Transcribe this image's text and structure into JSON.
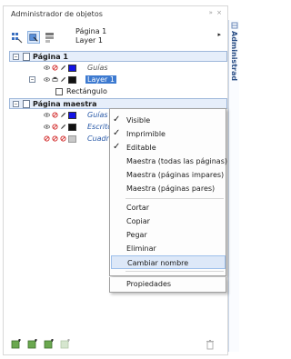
{
  "panel": {
    "title": "Administrador de objetos",
    "window_buttons": "» ×",
    "dock_tab_label": "Administrad"
  },
  "toolbar": {
    "page_name": "Página 1",
    "layer_name": "Layer 1",
    "arrow": "▸"
  },
  "tree": {
    "page1_label": "Página 1",
    "guides_label": "Guías",
    "layer1_label": "Layer 1",
    "rect_label": "Rectángulo",
    "master_label": "Página maestra",
    "master_guides_label": "Guías",
    "master_desktop_label": "Escritorio",
    "master_grid_label": "Cuadrícula"
  },
  "context_menu": {
    "items": [
      {
        "label": "Visible",
        "checked": true
      },
      {
        "label": "Imprimible",
        "checked": true
      },
      {
        "label": "Editable",
        "checked": true
      },
      {
        "label": "Maestra (todas las páginas)",
        "checked": false
      },
      {
        "label": "Maestra (páginas impares)",
        "checked": false
      },
      {
        "label": "Maestra (páginas pares)",
        "checked": false
      },
      {
        "label": "Cortar",
        "checked": false
      },
      {
        "label": "Copiar",
        "checked": false
      },
      {
        "label": "Pegar",
        "checked": false
      },
      {
        "label": "Eliminar",
        "checked": false
      },
      {
        "label": "Cambiar nombre",
        "checked": false
      },
      {
        "label": "Propiedades",
        "checked": false
      }
    ],
    "check_glyph": "✓"
  },
  "colors": {
    "accent_blue": "#3d7ad0",
    "layer_swatch_blue": "#1414e6",
    "menu_hover": "#dde8f8"
  }
}
